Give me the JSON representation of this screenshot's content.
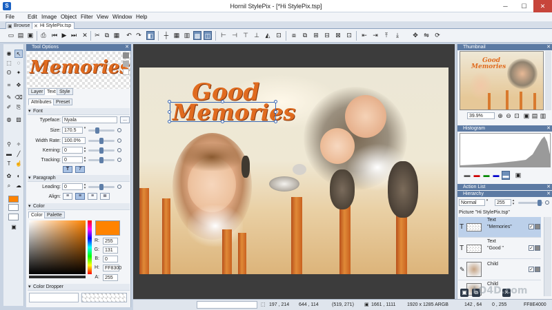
{
  "window": {
    "title": "Hornil StylePix - [*Hi StylePix.tsp]",
    "minimize": "─",
    "maximize": "☐",
    "close": "✕",
    "app_icon": "S"
  },
  "menu": [
    "File",
    "Edit",
    "Image",
    "Object",
    "Filter",
    "View",
    "Window",
    "Help"
  ],
  "tabs": [
    {
      "label": "Browse",
      "icon": "▣"
    },
    {
      "label": "Hi StylePix.tsp",
      "icon": "✕"
    }
  ],
  "panel": {
    "tool_options": "Tool Options",
    "preview_text": "Memories",
    "tabs": [
      "Layer",
      "Text",
      "Style"
    ],
    "subtabs": [
      "Attributes",
      "Preset"
    ],
    "font_section": "Font",
    "typeface_label": "Typeface:",
    "typeface_value": "Nyala",
    "size_label": "Size:",
    "size_value": "170.5",
    "width_rate_label": "Width Rate:",
    "width_rate_value": "100.0%",
    "kerning_label": "Kerning:",
    "kerning_value": "0",
    "tracking_label": "Tracking:",
    "tracking_value": "0",
    "bold_label": "T",
    "italic_label": "T",
    "paragraph_section": "Paragraph",
    "leading_label": "Leading:",
    "leading_value": "0",
    "align_label": "Align:",
    "color_section": "Color",
    "color_tabs": [
      "Color",
      "Palette"
    ],
    "rgb": {
      "r_label": "R:",
      "r": "255",
      "g_label": "G:",
      "g": "131",
      "b_label": "B:",
      "b": "0",
      "h_label": "H:",
      "hex": "FF8300",
      "a_label": "A:",
      "a": "255"
    },
    "dropper_section": "Color Dropper",
    "more_button": "..."
  },
  "right": {
    "thumbnail": "Thumbnail",
    "zoom": "39.9%",
    "histogram": "Histogram",
    "action_list": "Action List",
    "hierarchy": "Hierarchy",
    "blend_mode": "Normal",
    "opacity": "255",
    "root_label": "Picture \"Hi StylePix.tsp\"",
    "layers": [
      {
        "kind": "Text",
        "name": "\"Memories\"",
        "type_icon": "T"
      },
      {
        "kind": "Text",
        "name": "\"Good \"",
        "type_icon": "T"
      },
      {
        "kind": "Child",
        "name": "",
        "type_icon": "✎"
      },
      {
        "kind": "Child",
        "name": "",
        "type_icon": ""
      }
    ]
  },
  "canvas": {
    "line1": "Good",
    "line2": "Memories"
  },
  "status": {
    "pos": "197 , 214",
    "size": "644 , 114",
    "cursor": "(519, 271)",
    "dims": "1661 , 1111",
    "image": "1920 x 1285 ARGB",
    "coord2": "142 , 64",
    "val": "0 , 255",
    "color_hex": "FF8E4000"
  },
  "watermark": "LO4D.com",
  "colors": {
    "accent": "#5c7aa3",
    "text_orange": "#e06b1f",
    "fg_swatch": "#ff8300"
  }
}
